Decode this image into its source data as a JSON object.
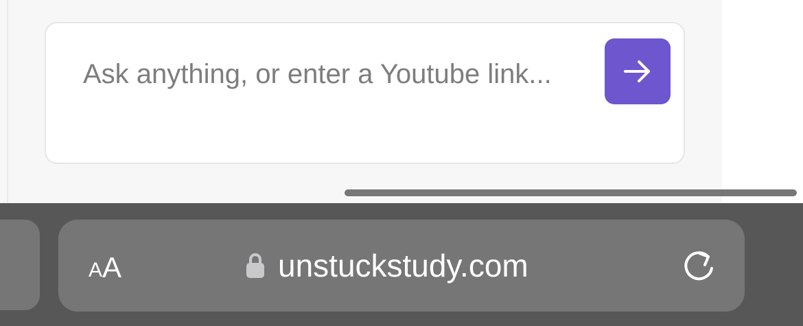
{
  "chat": {
    "placeholder": "Ask anything, or enter a Youtube link...",
    "value": "",
    "send_icon": "arrow-right-icon",
    "accent_color": "#6e56cf"
  },
  "browser": {
    "aa_small": "A",
    "aa_large": "A",
    "url": "unstuckstudy.com",
    "lock_icon": "lock-icon",
    "reload_icon": "reload-icon"
  }
}
